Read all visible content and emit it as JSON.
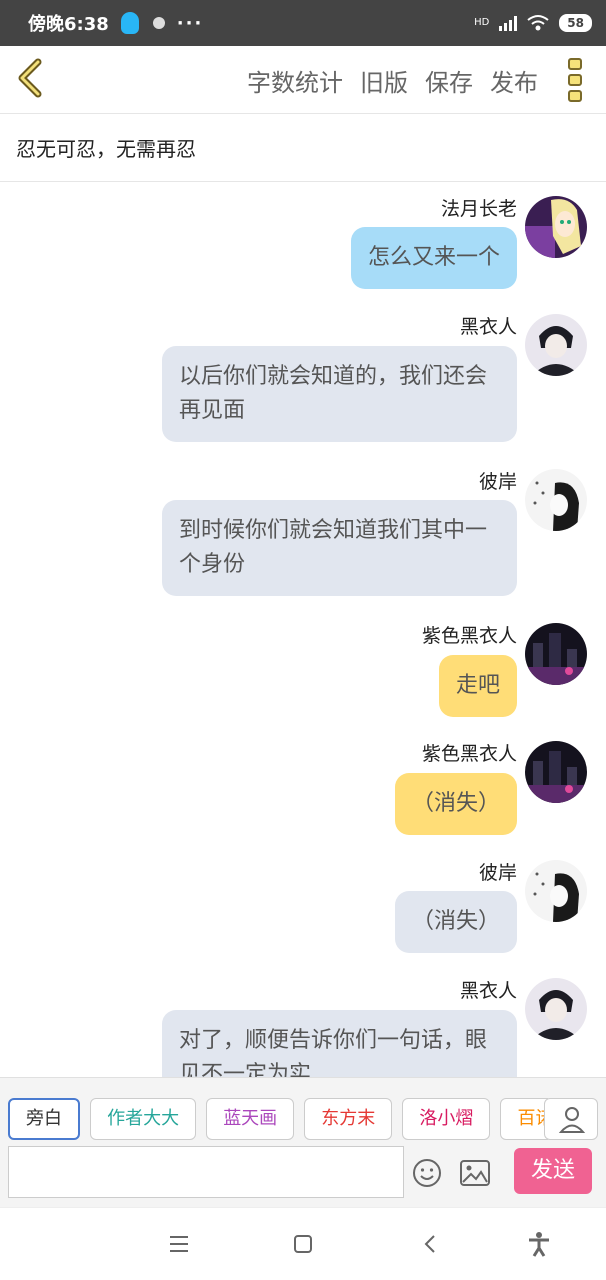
{
  "status_bar": {
    "time": "傍晚6:38",
    "network": "HD",
    "battery": "58",
    "more": "···"
  },
  "header": {
    "back_icon": "chevron-left-icon",
    "menu": [
      "字数统计",
      "旧版",
      "保存",
      "发布"
    ],
    "more_icon": "vertical-dots-icon"
  },
  "title": "忍无可忍，无需再忍",
  "messages": [
    {
      "name": "法月长老",
      "text": "怎么又来一个",
      "color": "#a7dcf8",
      "avatar": "blonde-girl-avatar"
    },
    {
      "name": "黑衣人",
      "text": "以后你们就会知道的，我们还会再见面",
      "color": "#e1e6ef",
      "avatar": "dark-boy-avatar"
    },
    {
      "name": "彼岸",
      "text": "到时候你们就会知道我们其中一个身份",
      "color": "#e1e6ef",
      "avatar": "girl-sketch-avatar"
    },
    {
      "name": "紫色黑衣人",
      "text": "走吧",
      "color": "#ffdd77",
      "avatar": "purple-city-avatar"
    },
    {
      "name": "紫色黑衣人",
      "text": "（消失）",
      "color": "#ffdd77",
      "avatar": "purple-city-avatar"
    },
    {
      "name": "彼岸",
      "text": "（消失）",
      "color": "#e1e6ef",
      "avatar": "girl-sketch-avatar"
    },
    {
      "name": "黑衣人",
      "text": "对了，顺便告诉你们一句话，眼见不一定为实",
      "color": "#e1e6ef",
      "avatar": "dark-boy-avatar"
    }
  ],
  "role_chips": [
    {
      "label": "旁白",
      "color": "#333333"
    },
    {
      "label": "作者大大",
      "color": "#26a69a"
    },
    {
      "label": "蓝天画",
      "color": "#ab47bc"
    },
    {
      "label": "东方末",
      "color": "#e53935"
    },
    {
      "label": "洛小熠",
      "color": "#d81b60"
    },
    {
      "label": "百诺",
      "color": "#fb8c00"
    }
  ],
  "input": {
    "placeholder": ""
  },
  "send_label": "发送",
  "nav": [
    "menu-icon",
    "home-icon",
    "back-icon",
    "accessibility-icon"
  ]
}
